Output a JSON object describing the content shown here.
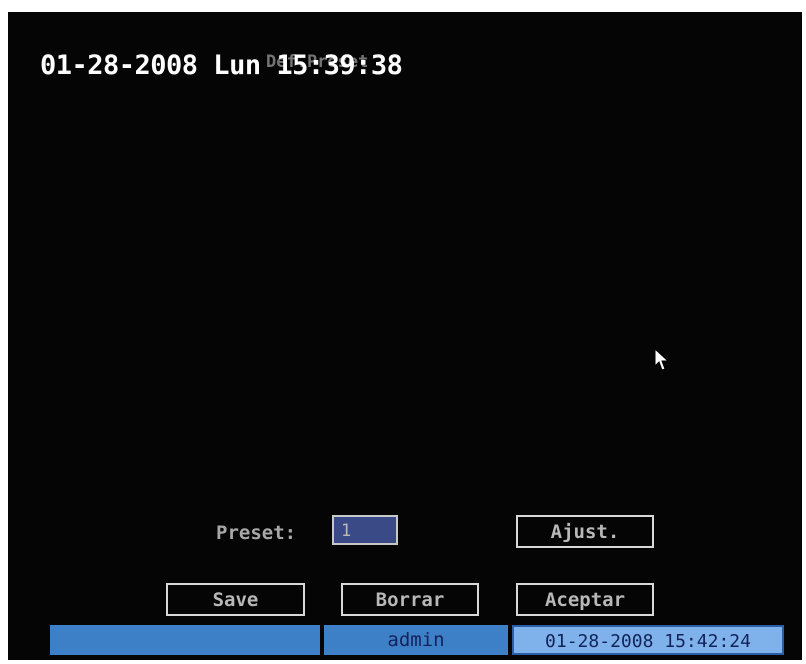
{
  "osd": {
    "timestamp": "01-28-2008 Lun 15:39:38",
    "dialog_title": "Def.Preset"
  },
  "preset": {
    "label": "Preset:",
    "value": "1"
  },
  "buttons": {
    "ajust": "Ajust.",
    "save": "Save",
    "borrar": "Borrar",
    "aceptar": "Aceptar"
  },
  "status_bar": {
    "left": "",
    "user": "admin",
    "datetime": "01-28-2008 15:42:24"
  },
  "colors": {
    "background": "#050505",
    "status_bar": "#3d80c8",
    "status_clock": "#7fb2ea",
    "input_fill": "#3a4a86"
  }
}
